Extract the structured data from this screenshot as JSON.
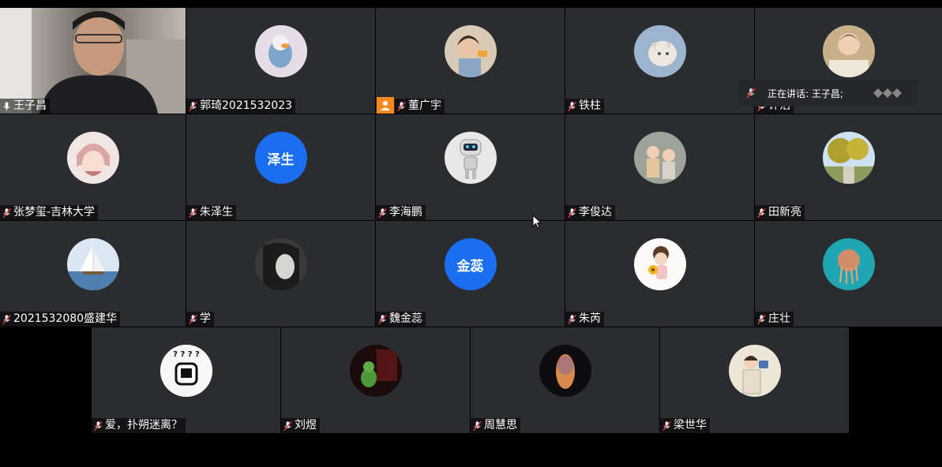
{
  "participants": [
    {
      "name": "王子昌",
      "video": true,
      "active_speaker": true
    },
    {
      "name": "郭琦2021532023"
    },
    {
      "name": "董广宇",
      "host": true
    },
    {
      "name": "铁柱"
    },
    {
      "name": "许浩",
      "obscured": true
    },
    {
      "name": "张梦玺-吉林大学"
    },
    {
      "name": "朱泽生",
      "avatar_text": "泽生",
      "avatar_color": "#1a6ff0"
    },
    {
      "name": "李海鹏"
    },
    {
      "name": "李俊达"
    },
    {
      "name": "田新亮"
    },
    {
      "name": "2021532080盛建华"
    },
    {
      "name": "学"
    },
    {
      "name": "魏金蕊",
      "avatar_text": "金蕊",
      "avatar_color": "#1a6ff0"
    },
    {
      "name": "朱芮"
    },
    {
      "name": "庄壮"
    },
    {
      "name": "爱，扑朔迷离？"
    },
    {
      "name": "刘煜"
    },
    {
      "name": "周慧思"
    },
    {
      "name": "梁世华"
    }
  ],
  "speaking_indicator": {
    "label": "正在讲话: 王子昌;"
  },
  "emoji_avatar_text": "? ? ? ?",
  "colors": {
    "tile_bg": "#2b2c30",
    "active_border": "#2ec36a",
    "host_badge": "#f58a1f",
    "avatar_blue": "#1a6ff0"
  }
}
